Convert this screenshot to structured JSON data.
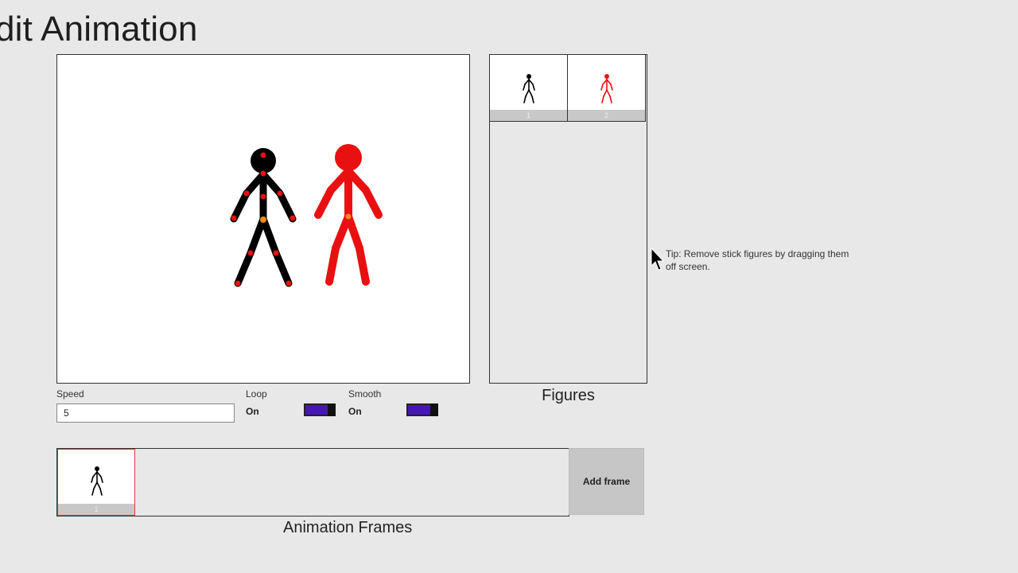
{
  "header": {
    "title": "dit Animation"
  },
  "figures": {
    "label": "Figures",
    "items": [
      {
        "number": "1",
        "color": "#000000"
      },
      {
        "number": "2",
        "color": "#e81010"
      }
    ]
  },
  "controls": {
    "speed_label": "Speed",
    "speed_value": "5",
    "loop_label": "Loop",
    "loop_state": "On",
    "smooth_label": "Smooth",
    "smooth_state": "On",
    "toggle_color": "#4617b4"
  },
  "frames": {
    "label": "Animation Frames",
    "items": [
      {
        "number": "1"
      }
    ],
    "add_label": "Add frame"
  },
  "tip": {
    "text": "Tip: Remove stick figures by dragging them off screen."
  },
  "colors": {
    "joint": "#e81010",
    "center_joint": "#f08a18",
    "figure_black": "#000000",
    "figure_red": "#e81010"
  }
}
